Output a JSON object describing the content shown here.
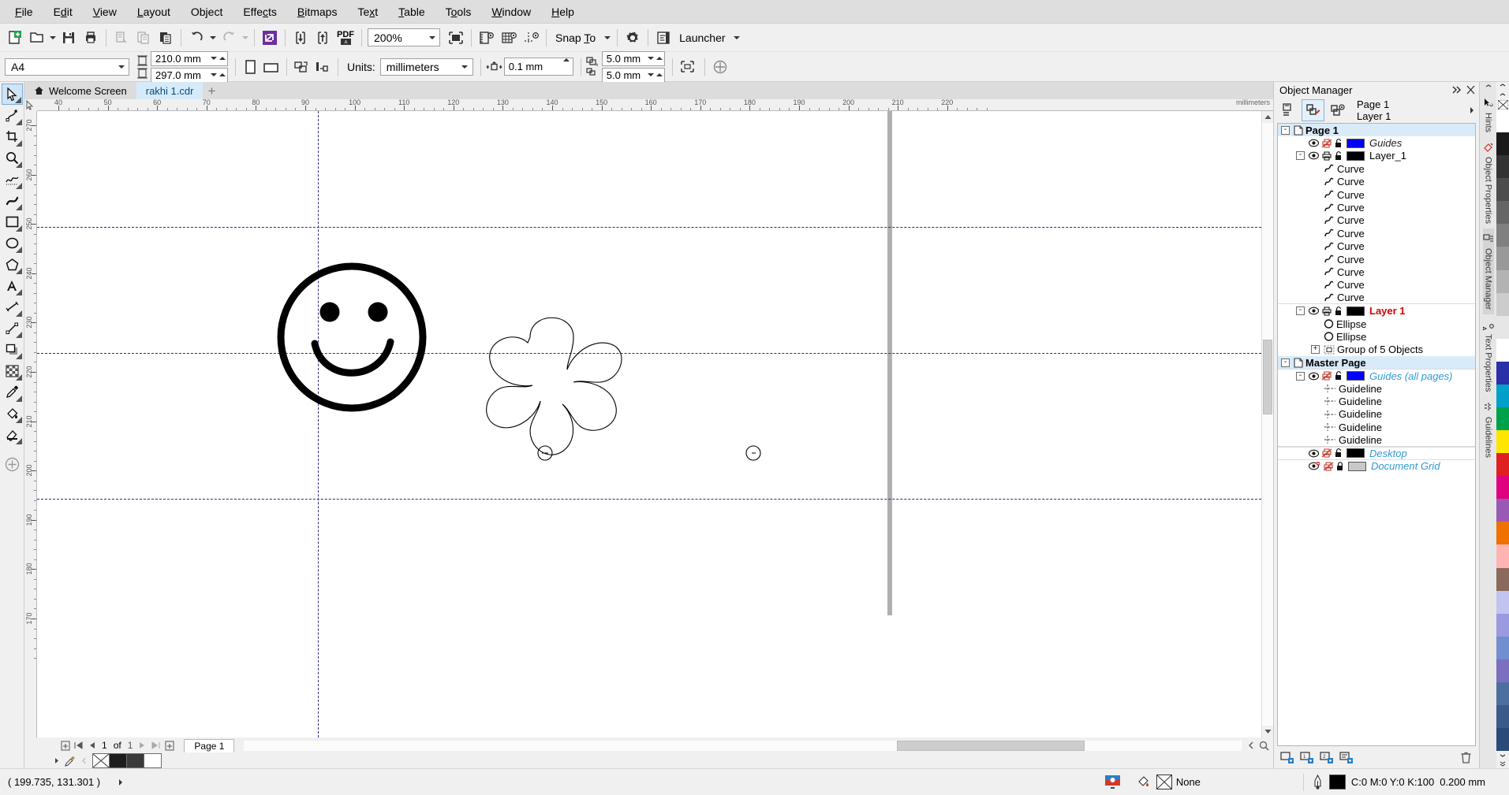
{
  "app": {
    "title": "CorelDRAW"
  },
  "menubar": {
    "items": [
      {
        "label": "File"
      },
      {
        "label": "Edit"
      },
      {
        "label": "View"
      },
      {
        "label": "Layout"
      },
      {
        "label": "Object"
      },
      {
        "label": "Effects"
      },
      {
        "label": "Bitmaps"
      },
      {
        "label": "Text"
      },
      {
        "label": "Table"
      },
      {
        "label": "Tools"
      },
      {
        "label": "Window"
      },
      {
        "label": "Help"
      }
    ]
  },
  "toolbar": {
    "new_icon": "new-document-icon",
    "open_icon": "open-folder-icon",
    "save_icon": "save-icon",
    "print_icon": "print-icon",
    "cut_icon": "cut-icon",
    "copy_icon": "copy-icon",
    "paste_icon": "paste-icon",
    "undo_icon": "undo-icon",
    "redo_icon": "redo-icon",
    "import_icon": "import-icon",
    "export_icon": "export-icon",
    "pdf_label": "PDF",
    "zoom_value": "200%",
    "fullscreen_icon": "full-screen-preview-icon",
    "show_rulers_icon": "show-rulers-icon",
    "show_grid_icon": "show-grid-icon",
    "show_guidelines_icon": "show-guidelines-icon",
    "snap_to_label": "Snap To",
    "options_icon": "gear-icon",
    "launcher_icon": "launcher-icon",
    "launcher_label": "Launcher"
  },
  "propbar": {
    "page_size": "A4",
    "page_width": "210.0 mm",
    "page_height": "297.0 mm",
    "portrait_icon": "portrait-orientation-icon",
    "landscape_icon": "landscape-orientation-icon",
    "all_pages_icon": "apply-to-all-pages-icon",
    "current_page_icon": "apply-to-current-page-icon",
    "units_label": "Units:",
    "units_value": "millimeters",
    "nudge_icon": "nudge-offset-icon",
    "nudge_value": "0.1 mm",
    "duplicate_x_icon": "duplicate-distance-x-icon",
    "duplicate_x": "5.0 mm",
    "duplicate_y_icon": "duplicate-distance-y-icon",
    "duplicate_y": "5.0 mm",
    "treat_as_filled_icon": "treat-as-filled-icon",
    "snap_options_icon": "snap-options-icon"
  },
  "toolbox": {
    "tools": [
      {
        "name": "pick-tool",
        "label": "Pick"
      },
      {
        "name": "shape-tool",
        "label": "Shape"
      },
      {
        "name": "crop-tool",
        "label": "Crop"
      },
      {
        "name": "zoom-tool",
        "label": "Zoom"
      },
      {
        "name": "freehand-tool",
        "label": "Freehand"
      },
      {
        "name": "artistic-media-tool",
        "label": "Artistic Media"
      },
      {
        "name": "rectangle-tool",
        "label": "Rectangle"
      },
      {
        "name": "ellipse-tool",
        "label": "Ellipse"
      },
      {
        "name": "polygon-tool",
        "label": "Polygon"
      },
      {
        "name": "text-tool",
        "label": "Text"
      },
      {
        "name": "parallel-dimension-tool",
        "label": "Parallel Dimension"
      },
      {
        "name": "straight-line-connector-tool",
        "label": "Connector"
      },
      {
        "name": "drop-shadow-tool",
        "label": "Drop Shadow"
      },
      {
        "name": "transparency-tool",
        "label": "Transparency"
      },
      {
        "name": "color-eyedropper-tool",
        "label": "Color Eyedropper"
      },
      {
        "name": "interactive-fill-tool",
        "label": "Interactive Fill"
      },
      {
        "name": "smart-fill-tool",
        "label": "Smart Fill"
      },
      {
        "name": "quick-customize-tool",
        "label": "Quick Customize"
      }
    ]
  },
  "tabs": {
    "items": [
      {
        "label": "Welcome Screen",
        "icon": "home-icon",
        "active": false
      },
      {
        "label": "rakhi 1.cdr",
        "icon": "",
        "active": true
      }
    ],
    "add_label": "+"
  },
  "rulers": {
    "unit_label": "millimeters",
    "h_labels": [
      "40",
      "50",
      "60",
      "70",
      "80",
      "90",
      "100",
      "110",
      "120",
      "130",
      "140",
      "150",
      "160",
      "170",
      "180",
      "190",
      "200",
      "210",
      "220"
    ],
    "v_labels": [
      "270",
      "260",
      "250",
      "240",
      "230",
      "220",
      "210",
      "200",
      "190",
      "180",
      "170"
    ]
  },
  "canvas": {
    "artwork": [
      {
        "name": "smiley-face",
        "description": "Smiley face: heavy black circle outline with two filled eyes and a smile arc"
      },
      {
        "name": "flower-shape",
        "description": "Six-petal flower outline with two small circles"
      }
    ]
  },
  "docker": {
    "title": "Object Manager",
    "collapse_icon": "collapse-docker-icon",
    "close_icon": "close-icon",
    "new_layer_icon": "new-layer-icon",
    "layer_manager_view_icon": "layer-manager-view-icon",
    "show_object_properties_icon": "show-object-properties-icon",
    "context_line1": "Page 1",
    "context_line2": "Layer 1",
    "flyout_icon": "flyout-arrow-icon",
    "tree": [
      {
        "indent": 0,
        "expander": "-",
        "icon": "page-icon",
        "label": "Page 1",
        "style": "bold",
        "selected": true
      },
      {
        "indent": 1,
        "expander": "",
        "icon": "eye-icon,print-disabled-icon,unlock-icon",
        "swatch": "#0000ff",
        "label": "Guides",
        "style": "italic-dark"
      },
      {
        "indent": 1,
        "expander": "-",
        "icon": "eye-icon,print-icon,unlock-icon",
        "swatch": "#000000",
        "label": "Layer_1",
        "style": "normal"
      },
      {
        "indent": 2,
        "expander": "",
        "icon": "curve-icon",
        "label": "Curve",
        "style": "normal"
      },
      {
        "indent": 2,
        "expander": "",
        "icon": "curve-icon",
        "label": "Curve",
        "style": "normal"
      },
      {
        "indent": 2,
        "expander": "",
        "icon": "curve-icon",
        "label": "Curve",
        "style": "normal"
      },
      {
        "indent": 2,
        "expander": "",
        "icon": "curve-icon",
        "label": "Curve",
        "style": "normal"
      },
      {
        "indent": 2,
        "expander": "",
        "icon": "curve-icon",
        "label": "Curve",
        "style": "normal"
      },
      {
        "indent": 2,
        "expander": "",
        "icon": "curve-icon",
        "label": "Curve",
        "style": "normal"
      },
      {
        "indent": 2,
        "expander": "",
        "icon": "curve-icon",
        "label": "Curve",
        "style": "normal"
      },
      {
        "indent": 2,
        "expander": "",
        "icon": "curve-icon",
        "label": "Curve",
        "style": "normal"
      },
      {
        "indent": 2,
        "expander": "",
        "icon": "curve-icon",
        "label": "Curve",
        "style": "normal"
      },
      {
        "indent": 2,
        "expander": "",
        "icon": "curve-icon",
        "label": "Curve",
        "style": "normal"
      },
      {
        "indent": 2,
        "expander": "",
        "icon": "curve-icon",
        "label": "Curve",
        "style": "normal"
      },
      {
        "indent": 1,
        "expander": "-",
        "icon": "eye-icon,print-icon,unlock-icon",
        "swatch": "#000000",
        "label": "Layer 1",
        "style": "bold-red"
      },
      {
        "indent": 2,
        "expander": "",
        "icon": "ellipse-icon",
        "label": "Ellipse",
        "style": "normal"
      },
      {
        "indent": 2,
        "expander": "",
        "icon": "ellipse-icon",
        "label": "Ellipse",
        "style": "normal"
      },
      {
        "indent": 2,
        "expander": "+",
        "icon": "group-icon",
        "label": "Group of 5 Objects",
        "style": "normal"
      },
      {
        "indent": 0,
        "expander": "-",
        "icon": "page-icon",
        "label": "Master Page",
        "style": "bold",
        "selected": true
      },
      {
        "indent": 1,
        "expander": "-",
        "icon": "eye-icon,print-disabled-icon,unlock-icon",
        "swatch": "#0000ff",
        "label": "Guides (all pages)",
        "style": "italic-blue"
      },
      {
        "indent": 2,
        "expander": "",
        "icon": "guideline-icon",
        "label": "Guideline",
        "style": "normal"
      },
      {
        "indent": 2,
        "expander": "",
        "icon": "guideline-icon",
        "label": "Guideline",
        "style": "normal"
      },
      {
        "indent": 2,
        "expander": "",
        "icon": "guideline-icon",
        "label": "Guideline",
        "style": "normal"
      },
      {
        "indent": 2,
        "expander": "",
        "icon": "guideline-icon",
        "label": "Guideline",
        "style": "normal"
      },
      {
        "indent": 2,
        "expander": "",
        "icon": "guideline-icon",
        "label": "Guideline",
        "style": "normal"
      },
      {
        "indent": 1,
        "expander": "",
        "icon": "eye-icon,print-disabled-icon,unlock-icon",
        "swatch": "#000000",
        "label": "Desktop",
        "style": "italic-blue"
      },
      {
        "indent": 1,
        "expander": "",
        "icon": "eye-disabled-icon,print-disabled-icon,lock-icon",
        "swatch": "#c8c8c8",
        "label": "Document Grid",
        "style": "italic-blue"
      }
    ],
    "footer": {
      "new_layer_icon": "new-layer-icon",
      "new_master_layer_odd_icon": "new-master-layer-odd-icon",
      "new_master_layer_even_icon": "new-master-layer-even-icon",
      "new_master_layer_all_icon": "new-master-layer-all-icon",
      "delete_icon": "delete-icon"
    }
  },
  "rail": {
    "tabs": [
      {
        "label": "Hints",
        "icon": "hints-icon",
        "active": false
      },
      {
        "label": "Object Properties",
        "icon": "object-properties-icon",
        "active": false
      },
      {
        "label": "Object Manager",
        "icon": "object-manager-icon",
        "active": true
      },
      {
        "label": "Text Properties",
        "icon": "text-properties-icon",
        "active": false
      },
      {
        "label": "Guidelines",
        "icon": "guidelines-icon",
        "active": false
      }
    ]
  },
  "palette": {
    "scroll_up_icon": "palette-scroll-up-icon",
    "scroll_down_icon": "palette-scroll-down-icon",
    "expand_icon": "palette-expand-icon",
    "colors": [
      "#ffffff",
      "#1a1a1a",
      "#333333",
      "#4d4d4d",
      "#666666",
      "#808080",
      "#999999",
      "#b3b3b3",
      "#cccccc",
      "#e6e6e6",
      "#ffffff",
      "#2b2fa8",
      "#00a0c8",
      "#00a14b",
      "#ffe600",
      "#e02020",
      "#e0007f",
      "#9b59b6",
      "#f07000",
      "#ffb3b3",
      "#8a6a5a",
      "#c3c3ef",
      "#9a9ae0",
      "#6f8fd0",
      "#7a6fc0",
      "#4d6fa0",
      "#3a5a8a",
      "#2a4a7a"
    ]
  },
  "pagenav": {
    "insert_before_icon": "insert-page-before-icon",
    "first_icon": "first-page-icon",
    "prev_icon": "previous-page-icon",
    "current": "1",
    "of_label": "of",
    "total": "1",
    "next_icon": "next-page-icon",
    "last_icon": "last-page-icon",
    "insert_after_icon": "insert-page-after-icon",
    "page_tab": "Page 1"
  },
  "colorstrip": {
    "expand_icon": "color-strip-expand-icon",
    "eyedropper_icon": "eyedropper-icon",
    "prev_icon": "color-strip-prev-icon",
    "none_swatch": "none-swatch",
    "swatches": [
      "#1d1d1d",
      "#3a3a3a",
      "#ffffff"
    ]
  },
  "statusbar": {
    "coordinates": "( 199.735, 131.301 )",
    "expand_icon": "status-expand-icon",
    "color_proof_icon": "color-proof-settings-icon",
    "fill_icon": "fill-color-icon",
    "fill_value": "None",
    "outline_icon": "outline-pen-icon",
    "outline_color": "#000000",
    "outline_value": "C:0 M:0 Y:0 K:100",
    "outline_width": "0.200 mm"
  }
}
